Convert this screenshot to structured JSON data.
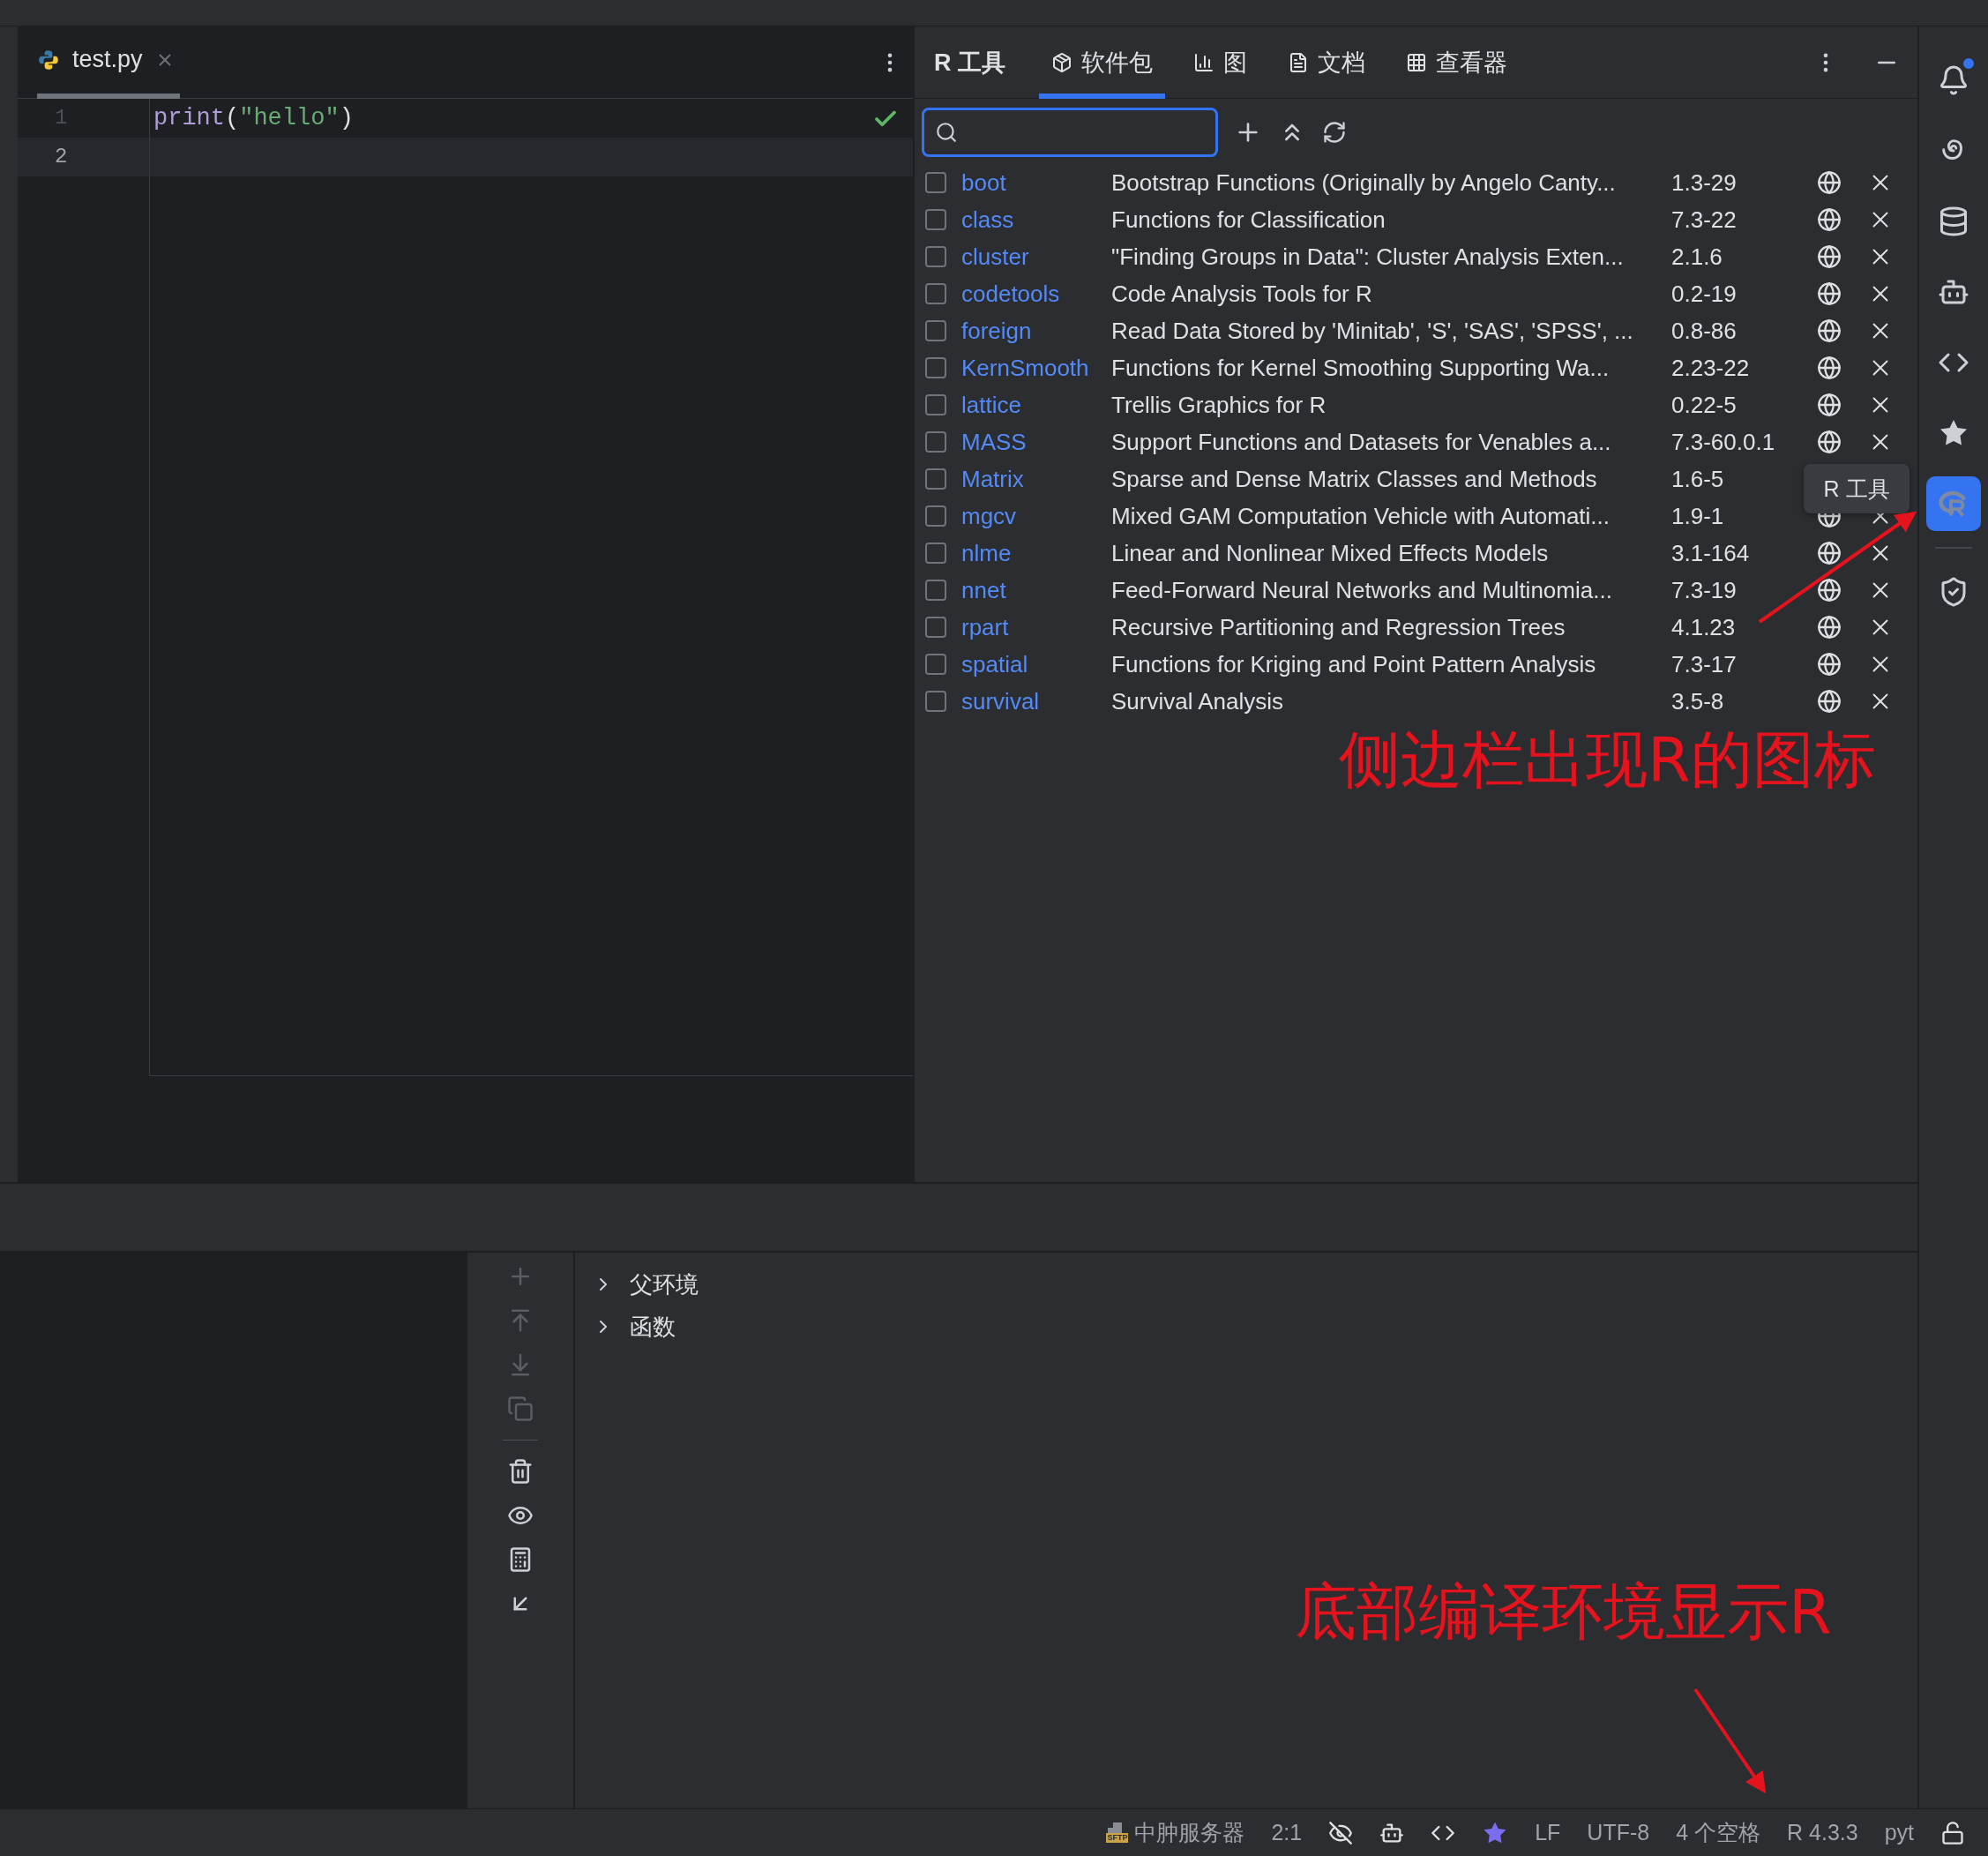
{
  "editor": {
    "tab": {
      "label": "test.py",
      "selected": true
    },
    "lines": [
      {
        "number": "1",
        "current": false,
        "tokens": [
          {
            "kind": "function",
            "text": "print"
          },
          {
            "kind": "punct",
            "text": "("
          },
          {
            "kind": "string",
            "text": "\"hello\""
          },
          {
            "kind": "punct",
            "text": ")"
          }
        ]
      },
      {
        "number": "2",
        "current": true
      }
    ]
  },
  "r_panel": {
    "title": "R 工具",
    "tabs": [
      {
        "label": "软件包",
        "kind": "package",
        "selected": true
      },
      {
        "label": "图",
        "kind": "plots",
        "selected": false
      },
      {
        "label": "文档",
        "kind": "docs",
        "selected": false
      },
      {
        "label": "查看器",
        "kind": "viewer",
        "selected": false
      }
    ],
    "packages": [
      {
        "name": "boot",
        "description": "Bootstrap Functions (Originally by Angelo Canty...",
        "version": "1.3-29",
        "checked": false
      },
      {
        "name": "class",
        "description": "Functions for Classification",
        "version": "7.3-22",
        "checked": false
      },
      {
        "name": "cluster",
        "description": "\"Finding Groups in Data\": Cluster Analysis Exten...",
        "version": "2.1.6",
        "checked": false
      },
      {
        "name": "codetools",
        "description": "Code Analysis Tools for R",
        "version": "0.2-19",
        "checked": false
      },
      {
        "name": "foreign",
        "description": "Read Data Stored by 'Minitab', 'S', 'SAS', 'SPSS', ...",
        "version": "0.8-86",
        "checked": false
      },
      {
        "name": "KernSmooth",
        "description": "Functions for Kernel Smoothing Supporting Wa...",
        "version": "2.23-22",
        "checked": false
      },
      {
        "name": "lattice",
        "description": "Trellis Graphics for R",
        "version": "0.22-5",
        "checked": false
      },
      {
        "name": "MASS",
        "description": "Support Functions and Datasets for Venables a...",
        "version": "7.3-60.0.1",
        "checked": false
      },
      {
        "name": "Matrix",
        "description": "Sparse and Dense Matrix Classes and Methods",
        "version": "1.6-5",
        "checked": false
      },
      {
        "name": "mgcv",
        "description": "Mixed GAM Computation Vehicle with Automati...",
        "version": "1.9-1",
        "checked": false
      },
      {
        "name": "nlme",
        "description": "Linear and Nonlinear Mixed Effects Models",
        "version": "3.1-164",
        "checked": false
      },
      {
        "name": "nnet",
        "description": "Feed-Forward Neural Networks and Multinomia...",
        "version": "7.3-19",
        "checked": false
      },
      {
        "name": "rpart",
        "description": "Recursive Partitioning and Regression Trees",
        "version": "4.1.23",
        "checked": false
      },
      {
        "name": "spatial",
        "description": "Functions for Kriging and Point Pattern Analysis",
        "version": "7.3-17",
        "checked": false
      },
      {
        "name": "survival",
        "description": "Survival Analysis",
        "version": "3.5-8",
        "checked": false
      }
    ]
  },
  "tooltip": "R 工具",
  "sidebar": [
    {
      "kind": "bell",
      "selected": false,
      "notification": true
    },
    {
      "kind": "swirl",
      "selected": false
    },
    {
      "kind": "database",
      "selected": false
    },
    {
      "kind": "robot",
      "selected": false
    },
    {
      "kind": "code",
      "selected": false
    },
    {
      "kind": "star",
      "selected": false
    },
    {
      "kind": "r",
      "selected": true
    },
    {
      "kind": "shield",
      "selected": false
    }
  ],
  "env_toolbar": [
    {
      "kind": "add",
      "disabled": true
    },
    {
      "kind": "up",
      "disabled": true
    },
    {
      "kind": "down",
      "disabled": true
    },
    {
      "kind": "copy",
      "disabled": true
    },
    {
      "kind": "separator"
    },
    {
      "kind": "delete",
      "disabled": false
    },
    {
      "kind": "watch",
      "disabled": false
    },
    {
      "kind": "calculator",
      "disabled": false
    },
    {
      "kind": "collapse",
      "disabled": false
    }
  ],
  "env_tree": [
    {
      "label": "父环境",
      "expanded": false
    },
    {
      "label": "函数",
      "expanded": false
    }
  ],
  "annotations": [
    "侧边栏出现R的图标",
    "底部编译环境显示R"
  ],
  "status_bar": [
    {
      "kind": "server",
      "text": "中肿服务器",
      "icon_label": "SFTP"
    },
    {
      "kind": "text",
      "text": "2:1"
    },
    {
      "kind": "hidden-eye"
    },
    {
      "kind": "robot"
    },
    {
      "kind": "code"
    },
    {
      "kind": "star"
    },
    {
      "kind": "text",
      "text": "LF"
    },
    {
      "kind": "text",
      "text": "UTF-8"
    },
    {
      "kind": "text",
      "text": "4 个空格"
    },
    {
      "kind": "text",
      "text": "R 4.3.3"
    },
    {
      "kind": "text",
      "text": "pyt"
    },
    {
      "kind": "lock"
    }
  ]
}
